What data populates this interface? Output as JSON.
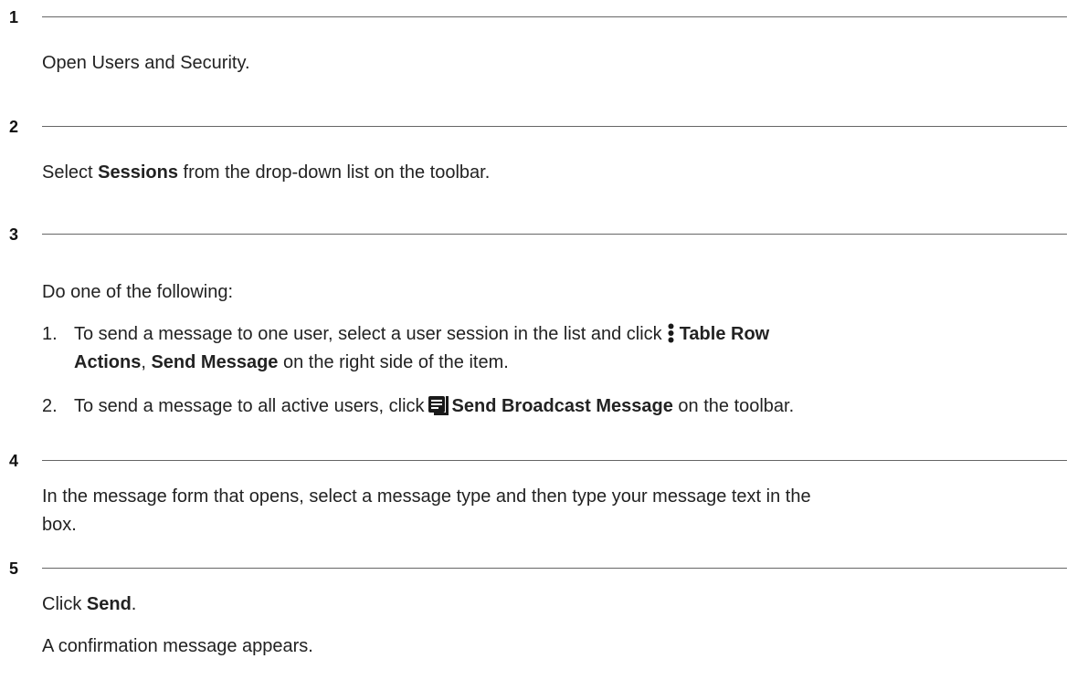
{
  "steps": [
    {
      "number": "1",
      "text": "Open Users and Security."
    },
    {
      "number": "2",
      "pre": "Select ",
      "bold": "Sessions",
      "post": " from the drop-down list on the toolbar."
    },
    {
      "number": "3",
      "intro": "Do one of the following:",
      "items": [
        {
          "marker": "1.",
          "pre": "To send a message to one user, select a user session in the list and click",
          "icon": "kebab-vertical-icon",
          "bold1": "Table Row",
          "bold1b": "Actions",
          "sep": ", ",
          "bold2": "Send Message",
          "post": " on the right side of the item."
        },
        {
          "marker": "2.",
          "pre": "To send a message to all active users, click",
          "icon": "broadcast-message-icon",
          "bold": "Send Broadcast Message",
          "post": " on the toolbar."
        }
      ]
    },
    {
      "number": "4",
      "line1": "In the message form that opens, select a message type and then type your message text in the",
      "line2": "box."
    },
    {
      "number": "5",
      "pre": "Click ",
      "bold": "Send",
      "post": ".",
      "result": "A confirmation message appears."
    }
  ],
  "colors": {
    "text": "#222222",
    "rule": "#666666",
    "icon": "#1a1a1a"
  }
}
